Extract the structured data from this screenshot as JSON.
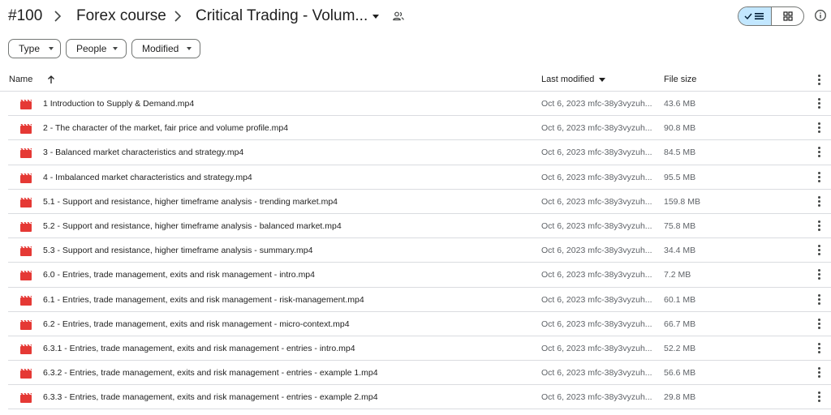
{
  "breadcrumb": {
    "items": [
      "#100",
      "Forex course",
      "Critical Trading - Volum..."
    ]
  },
  "icons": {
    "separator": "chevron-right-icon",
    "dropdown": "caret-down-icon",
    "shared": "people-icon",
    "list_view": "list-view-icon",
    "grid_view": "grid-view-icon",
    "info": "info-icon",
    "sort": "arrow-up-icon",
    "more": "more-vert-icon",
    "file": "video-file-icon"
  },
  "colors": {
    "accent": "#c2e7ff",
    "video_icon": "#e53935",
    "divider": "#dadce0"
  },
  "filters": [
    "Type",
    "People",
    "Modified"
  ],
  "columns": {
    "name": "Name",
    "modified": "Last modified",
    "size": "File size"
  },
  "files": [
    {
      "name": "1 Introduction to Supply & Demand.mp4",
      "modified": "Oct 6, 2023 mfc-38y3vyzuh...",
      "size": "43.6 MB"
    },
    {
      "name": "2 - The character of the market, fair price and volume profile.mp4",
      "modified": "Oct 6, 2023 mfc-38y3vyzuh...",
      "size": "90.8 MB"
    },
    {
      "name": "3 - Balanced market characteristics and strategy.mp4",
      "modified": "Oct 6, 2023 mfc-38y3vyzuh...",
      "size": "84.5 MB"
    },
    {
      "name": "4 - Imbalanced market characteristics and strategy.mp4",
      "modified": "Oct 6, 2023 mfc-38y3vyzuh...",
      "size": "95.5 MB"
    },
    {
      "name": "5.1 - Support and resistance, higher timeframe analysis - trending market.mp4",
      "modified": "Oct 6, 2023 mfc-38y3vyzuh...",
      "size": "159.8 MB"
    },
    {
      "name": "5.2 - Support and resistance, higher timeframe analysis - balanced market.mp4",
      "modified": "Oct 6, 2023 mfc-38y3vyzuh...",
      "size": "75.8 MB"
    },
    {
      "name": "5.3 - Support and resistance, higher timeframe analysis - summary.mp4",
      "modified": "Oct 6, 2023 mfc-38y3vyzuh...",
      "size": "34.4 MB"
    },
    {
      "name": "6.0 - Entries, trade management, exits and risk management - intro.mp4",
      "modified": "Oct 6, 2023 mfc-38y3vyzuh...",
      "size": "7.2 MB"
    },
    {
      "name": "6.1 - Entries, trade management, exits and risk management - risk-management.mp4",
      "modified": "Oct 6, 2023 mfc-38y3vyzuh...",
      "size": "60.1 MB"
    },
    {
      "name": "6.2 - Entries, trade management, exits and risk management - micro-context.mp4",
      "modified": "Oct 6, 2023 mfc-38y3vyzuh...",
      "size": "66.7 MB"
    },
    {
      "name": "6.3.1 - Entries, trade management, exits and risk management - entries - intro.mp4",
      "modified": "Oct 6, 2023 mfc-38y3vyzuh...",
      "size": "52.2 MB"
    },
    {
      "name": "6.3.2 - Entries, trade management, exits and risk management - entries - example 1.mp4",
      "modified": "Oct 6, 2023 mfc-38y3vyzuh...",
      "size": "56.6 MB"
    },
    {
      "name": "6.3.3 - Entries, trade management, exits and risk management - entries - example 2.mp4",
      "modified": "Oct 6, 2023 mfc-38y3vyzuh...",
      "size": "29.8 MB"
    }
  ]
}
